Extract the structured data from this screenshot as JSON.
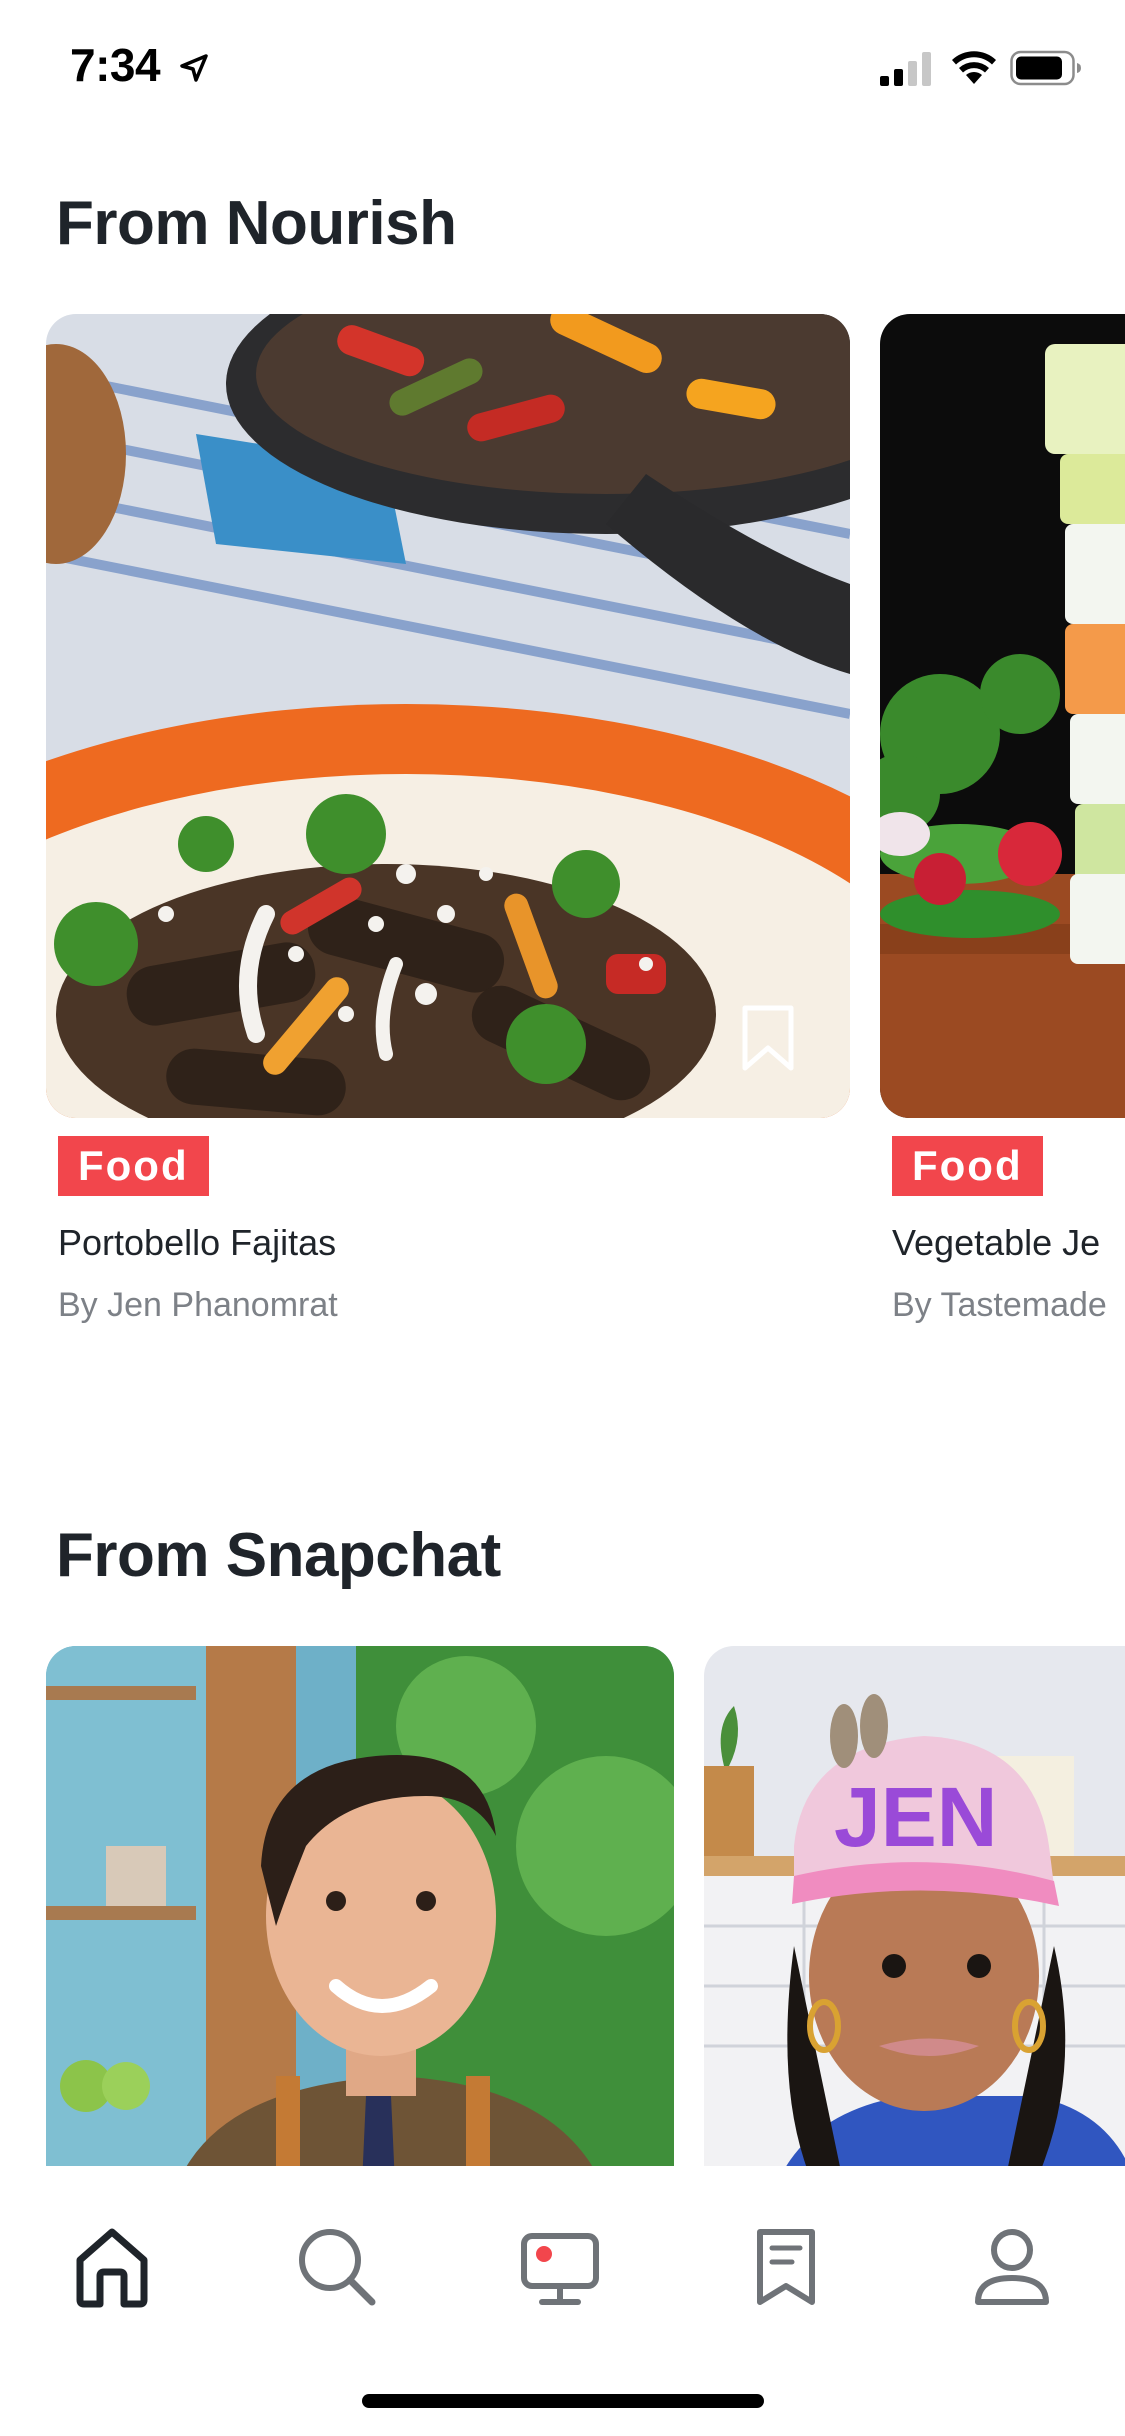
{
  "status_bar": {
    "time": "7:34"
  },
  "sections": [
    {
      "title": "From Nourish",
      "cards": [
        {
          "category": "Food",
          "title": "Portobello Fajitas",
          "author": "By Jen Phanomrat"
        },
        {
          "category": "Food",
          "title": "Vegetable Je",
          "author": "By Tastemade"
        }
      ]
    },
    {
      "title": "From Snapchat"
    }
  ],
  "colors": {
    "badge": "#f2464c",
    "text_dark": "#1f242a",
    "text_muted": "#7d8187"
  },
  "bottom_nav": {
    "items": [
      {
        "icon": "home-icon",
        "active": true
      },
      {
        "icon": "search-icon",
        "active": false
      },
      {
        "icon": "live-tv-icon",
        "active": false
      },
      {
        "icon": "saved-icon",
        "active": false
      },
      {
        "icon": "profile-icon",
        "active": false
      }
    ]
  }
}
